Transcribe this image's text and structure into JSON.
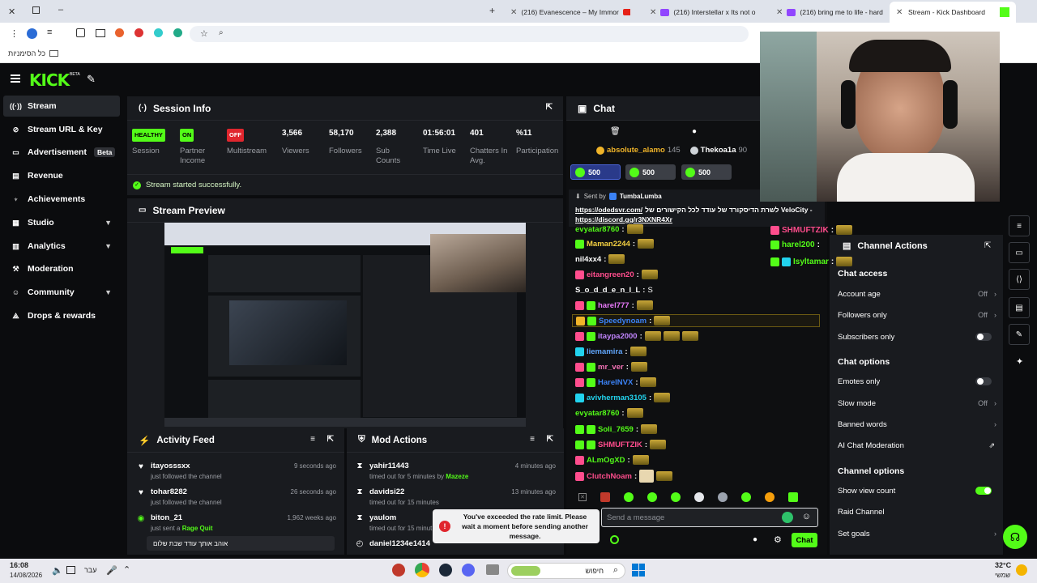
{
  "browser": {
    "tabs": [
      {
        "title": "(216) Evanescence – My Immor"
      },
      {
        "title": "(216) Interstellar x Its not o"
      },
      {
        "title": "(216) bring me to life - hard"
      },
      {
        "title": "Stream - Kick Dashboard"
      }
    ],
    "bookmarks_label": "כל הסימניות"
  },
  "header": {
    "logo": "KICK",
    "logo_tag": "BETA"
  },
  "sidebar": {
    "items": [
      {
        "label": "Stream",
        "icon": "stream-icon"
      },
      {
        "label": "Stream URL & Key",
        "icon": "link-icon"
      },
      {
        "label": "Advertisement",
        "badge": "Beta",
        "icon": "ad-icon"
      },
      {
        "label": "Revenue",
        "icon": "revenue-icon"
      },
      {
        "label": "Achievements",
        "icon": "trophy-icon"
      },
      {
        "label": "Studio",
        "icon": "studio-icon"
      },
      {
        "label": "Analytics",
        "icon": "chart-icon"
      },
      {
        "label": "Moderation",
        "icon": "hammer-icon"
      },
      {
        "label": "Community",
        "icon": "community-icon"
      },
      {
        "label": "Drops & rewards",
        "icon": "drops-icon"
      }
    ]
  },
  "session": {
    "title": "Session Info",
    "stats": [
      {
        "value": "HEALTHY",
        "label": "Session"
      },
      {
        "value": "ON",
        "label": "Partner Income"
      },
      {
        "value": "OFF",
        "label": "Multistream"
      },
      {
        "value": "3,566",
        "label": "Viewers"
      },
      {
        "value": "58,170",
        "label": "Followers"
      },
      {
        "value": "2,388",
        "label": "Sub Counts"
      },
      {
        "value": "01:56:01",
        "label": "Time Live"
      },
      {
        "value": "401",
        "label": "Chatters In Avg."
      },
      {
        "value": "%11",
        "label": "Participation"
      }
    ],
    "status_message": "Stream started successfully."
  },
  "preview": {
    "title": "Stream Preview"
  },
  "activity": {
    "title": "Activity Feed",
    "rows": [
      {
        "user": "itayosssxx",
        "action": "just followed the channel",
        "time": "9 seconds ago"
      },
      {
        "user": "tohar8282",
        "action": "just followed the channel",
        "time": "26 seconds ago"
      },
      {
        "user": "biton_21",
        "action": "just sent a",
        "highlight": "Rage Quit",
        "time": "1,962 weeks ago"
      }
    ],
    "message": "אוהב אותך עודד שבת שלום"
  },
  "mod": {
    "title": "Mod Actions",
    "rows": [
      {
        "user": "yahir11443",
        "action": "timed out for 5 minutes by",
        "by": "Mazeze",
        "time": "4 minutes ago"
      },
      {
        "user": "davidsi22",
        "action": "timed out for 15 minutes",
        "time": "13 minutes ago"
      },
      {
        "user": "yaulom",
        "action": "timed out for 15 minut"
      },
      {
        "user": "daniel1234e1414",
        "action": ""
      }
    ]
  },
  "chat": {
    "title": "Chat",
    "top_gifters": [
      {
        "name": "absolute_alamo",
        "count": "145"
      },
      {
        "name": "Thekoa1a",
        "count": "90"
      }
    ],
    "gift_counts": [
      "500",
      "500",
      "500"
    ],
    "pinned": {
      "sent_by_label": "Sent by",
      "sent_by_user": "TumbaLumba",
      "line1": "לשרת הדיסקורד של עודד לכל הקישורים של VeloCity -",
      "link1": "https://odedsvr.com/",
      "link2": "https://discord.gg/r3NXNR4Xr"
    },
    "messages": [
      {
        "user": "evyatar8760",
        "color": "#53fc18"
      },
      {
        "user": "Maman2244",
        "color": "#f5d142"
      },
      {
        "user": "nil4xx4",
        "color": "#ffffff"
      },
      {
        "user": "eitangreen20",
        "color": "#ff4d8d"
      },
      {
        "user": "S_o_d_d_e_n_I_L",
        "color": "#ffffff",
        "text": "S"
      },
      {
        "user": "harel777",
        "color": "#e879f9"
      },
      {
        "user": "Speedynoam",
        "color": "#3b82f6"
      },
      {
        "user": "itaypa2000",
        "color": "#c084fc"
      },
      {
        "user": "liemamira",
        "color": "#60a5fa"
      },
      {
        "user": "mr_ver",
        "color": "#f472b6"
      },
      {
        "user": "HareINVX",
        "color": "#3b82f6"
      },
      {
        "user": "avivherman3105",
        "color": "#22d3ee"
      },
      {
        "user": "evyatar8760",
        "color": "#53fc18"
      },
      {
        "user": "Soli_7659",
        "color": "#53fc18"
      },
      {
        "user": "SHMUFTZIK",
        "color": "#ff4d8d"
      },
      {
        "user": "ALmOgXD",
        "color": "#53fc18"
      },
      {
        "user": "ClutchNoam",
        "color": "#ff4d8d"
      }
    ],
    "overflow_messages": [
      {
        "user": "SHMUFTZIK",
        "color": "#ff4d8d"
      },
      {
        "user": "harel200",
        "color": "#53fc18"
      },
      {
        "user": "Isyltamar",
        "color": "#53fc18"
      }
    ],
    "input_placeholder": "Send a message",
    "send_label": "Chat",
    "rate_limit_message": "You've exceeded the rate limit. Please wait a moment before sending another message."
  },
  "channel_actions": {
    "title": "Channel Actions",
    "chat_access_title": "Chat access",
    "account_age": {
      "label": "Account age",
      "value": "Off"
    },
    "followers_only": {
      "label": "Followers only",
      "value": "Off"
    },
    "subscribers_only": {
      "label": "Subscribers only",
      "on": false
    },
    "chat_options_title": "Chat options",
    "emotes_only": {
      "label": "Emotes only",
      "on": false
    },
    "slow_mode": {
      "label": "Slow mode",
      "value": "Off"
    },
    "banned_words": {
      "label": "Banned words"
    },
    "ai_moderation": {
      "label": "AI Chat Moderation"
    },
    "channel_options_title": "Channel options",
    "show_view_count": {
      "label": "Show view count",
      "on": true
    },
    "raid_channel": {
      "label": "Raid Channel"
    },
    "set_goals": {
      "label": "Set goals"
    }
  },
  "taskbar": {
    "time": "16:08",
    "date": "14/08/2026",
    "lang": "עבר",
    "search": "חיפוש",
    "temp": "32°C",
    "weather": "שמשי"
  },
  "colors": {
    "accent": "#53fc18",
    "panel": "#191b1f",
    "bg": "#0b0c0e"
  }
}
